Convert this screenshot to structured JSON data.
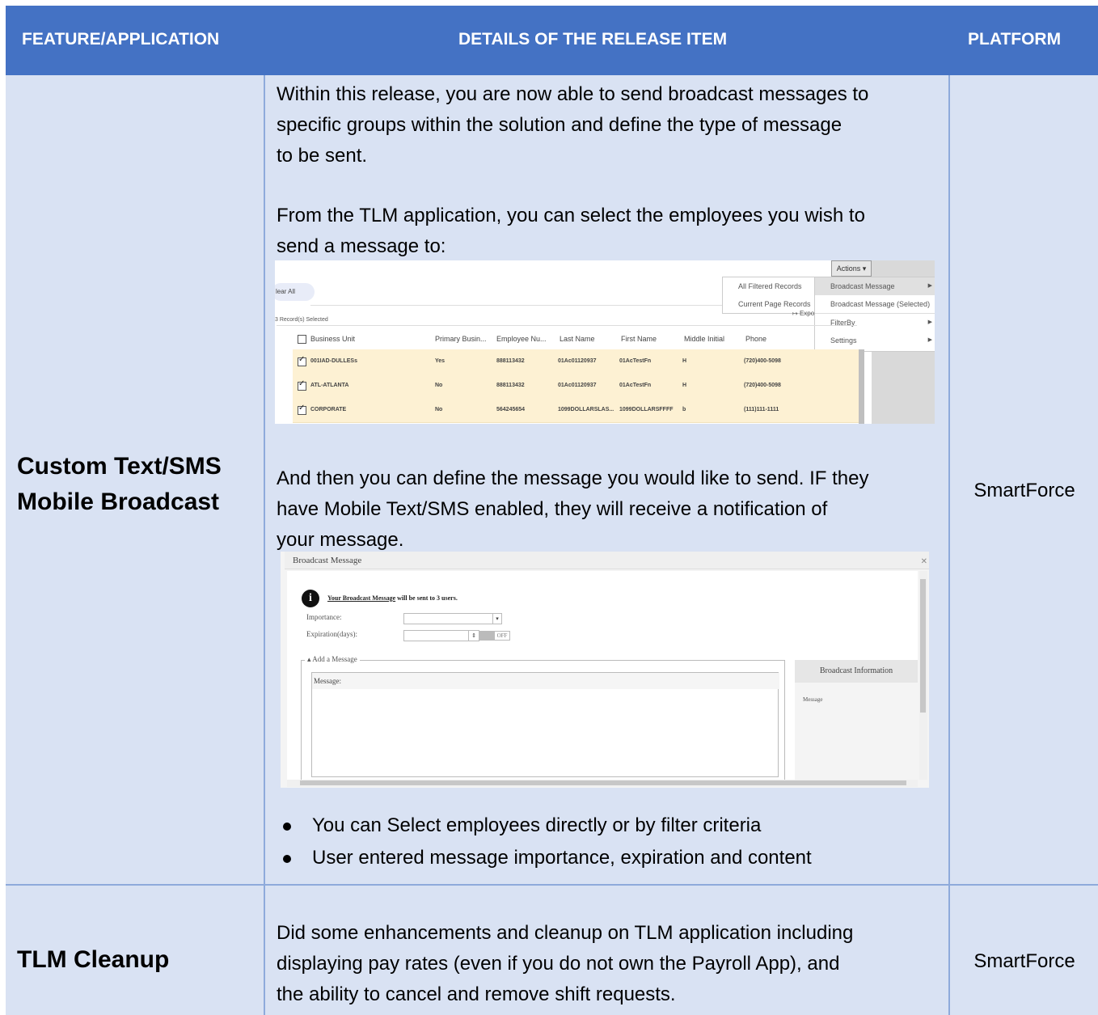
{
  "header": {
    "col1": "FEATURE/APPLICATION",
    "col2": "DETAILS OF THE RELEASE ITEM",
    "col3": "PLATFORM"
  },
  "row1": {
    "feature_line1": "Custom Text/SMS",
    "feature_line2": "Mobile Broadcast",
    "platform": "SmartForce",
    "para1_lines": [
      "Within this release, you are now able to send broadcast messages to",
      "specific groups within the solution and define the type of message",
      "to be sent."
    ],
    "para2_lines": [
      "From the TLM application, you can select the employees you wish to",
      "send a message to:"
    ],
    "para3_lines": [
      "And then you can define the message you would like to send. IF they",
      "have Mobile Text/SMS enabled, they will receive a notification of",
      "your message."
    ],
    "bullets": [
      "You can Select employees directly or by filter criteria",
      "User entered message importance, expiration and content"
    ]
  },
  "row2": {
    "feature": "TLM Cleanup",
    "platform": "SmartForce",
    "lines": [
      "Did some enhancements and cleanup on TLM application including",
      "displaying pay rates (even if you do not own the Payroll App), and",
      "the ability to cancel and remove shift requests."
    ]
  },
  "shot1": {
    "clear_all": "lear All",
    "actions": "Actions ▾",
    "menu_left": [
      "All Filtered Records",
      "Current Page Records"
    ],
    "menu_right": [
      "Broadcast Message",
      "Broadcast Message (Selected)",
      "FilterBy",
      "Settings"
    ],
    "export": "Expo",
    "records_selected": "3 Record(s) Selected",
    "columns": [
      "Business Unit",
      "Primary Busin...",
      "Employee Nu...",
      "Last Name",
      "First Name",
      "Middle Initial",
      "Phone"
    ],
    "rows": [
      [
        "001IAD-DULLESs",
        "Yes",
        "888113432",
        "01Ac01120937",
        "01AcTestFn",
        "H",
        "(720)400-5098"
      ],
      [
        "ATL-ATLANTA",
        "No",
        "888113432",
        "01Ac01120937",
        "01AcTestFn",
        "H",
        "(720)400-5098"
      ],
      [
        "CORPORATE",
        "No",
        "564245654",
        "1099DOLLARSLAS...",
        "1099DOLLARSFFFF",
        "b",
        "(111)111-1111"
      ]
    ]
  },
  "shot2": {
    "title": "Broadcast Message",
    "notice_prefix": "Your Broadcast Message",
    "notice_suffix": " will be sent to 3 users.",
    "importance_label": "Importance:",
    "expiration_label": "Expiration(days):",
    "toggle": "OFF",
    "group_label": "Add a Message",
    "message_label": "Message:",
    "side_header": "Broadcast Information",
    "side_item": "Message"
  }
}
